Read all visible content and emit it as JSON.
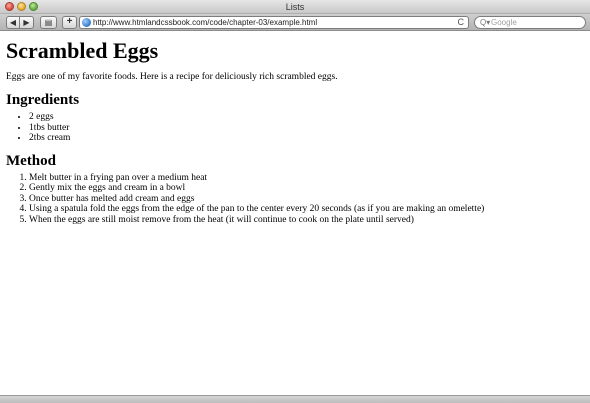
{
  "window": {
    "title": "Lists"
  },
  "toolbar": {
    "back_icon": "◀",
    "forward_icon": "▶",
    "bookmarks_icon": "▤",
    "add_icon": "+",
    "url": "http://www.htmlandcssbook.com/code/chapter-03/example.html",
    "reload_icon": "C",
    "search_icon": "Q▾",
    "search_placeholder": "Google"
  },
  "page": {
    "title": "Scrambled Eggs",
    "intro": "Eggs are one of my favorite foods. Here is a recipe for deliciously rich scrambled eggs.",
    "ingredients_heading": "Ingredients",
    "ingredients": [
      "2 eggs",
      "1tbs butter",
      "2tbs cream"
    ],
    "method_heading": "Method",
    "method": [
      "Melt butter in a frying pan over a medium heat",
      "Gently mix the eggs and cream in a bowl",
      "Once butter has melted add cream and eggs",
      "Using a spatula fold the eggs from the edge of the pan to the center every 20 seconds (as if you are making an omelette)",
      "When the eggs are still moist remove from the heat (it will continue to cook on the plate until served)"
    ]
  }
}
